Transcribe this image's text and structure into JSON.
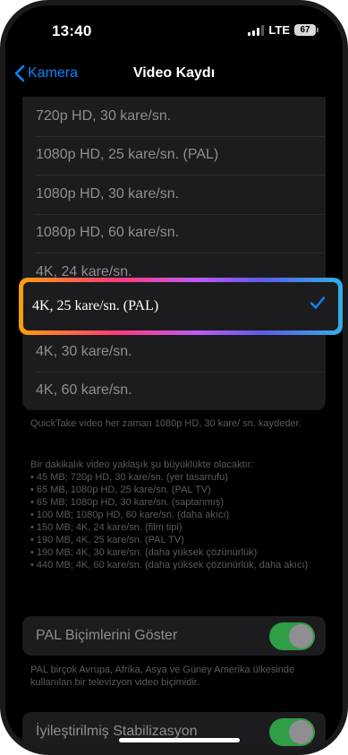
{
  "status": {
    "time": "13:40",
    "network": "LTE",
    "battery": "67"
  },
  "nav": {
    "back_label": "Kamera",
    "title": "Video Kaydı"
  },
  "formats": [
    {
      "label": "720p HD, 30 kare/sn."
    },
    {
      "label": "1080p HD, 25 kare/sn. (PAL)"
    },
    {
      "label": "1080p HD, 30 kare/sn."
    },
    {
      "label": "1080p HD, 60 kare/sn."
    },
    {
      "label": "4K, 24 kare/sn."
    }
  ],
  "selected_format": {
    "label": "4K, 25 kare/sn. (PAL)",
    "checked": true
  },
  "formats_after": [
    {
      "label": "4K, 30 kare/sn."
    },
    {
      "label": "4K, 60 kare/sn."
    }
  ],
  "notes": {
    "quicktake": "QuickTake video her zaman 1080p HD, 30 kare/ sn. kaydeder.",
    "size_intro": "Bir dakikalık video yaklaşık şu büyüklükte olacaktır:",
    "size_lines": [
      "• 45 MB; 720p HD, 30 kare/sn. (yer tasarrufu)",
      "• 65 MB, 1080p HD, 25 kare/sn. (PAL TV)",
      "• 65 MB; 1080p HD, 30 kare/sn. (saptanmış)",
      "• 100 MB; 1080p HD, 60 kare/sn. (daha akıcı)",
      "• 150 MB; 4K, 24 kare/sn. (film tipi)",
      "• 190 MB, 4K, 25 kare/sn. (PAL TV)",
      "• 190 MB; 4K, 30 kare/sn. (daha yüksek çözünürlük)",
      "• 440 MB; 4K, 60 kare/sn. (daha yüksek çözünürlük, daha akıcı)"
    ]
  },
  "pal_toggle": {
    "label": "PAL Biçimlerini Göster",
    "on": true
  },
  "pal_note": "PAL birçok Avrupa, Afrika, Asya ve Güney Amerika ülkesinde kullanılan bir televizyon video biçimidir.",
  "stabilization_toggle": {
    "label": "İyileştirilmiş Stabilizasyon",
    "on": true
  },
  "colors": {
    "accent": "#0a84ff",
    "toggle_on": "#2f9e44",
    "highlight_gradient": [
      "#ff9f0a",
      "#ff3b7a",
      "#bf5af2",
      "#5e5ce6",
      "#32ade6"
    ]
  }
}
